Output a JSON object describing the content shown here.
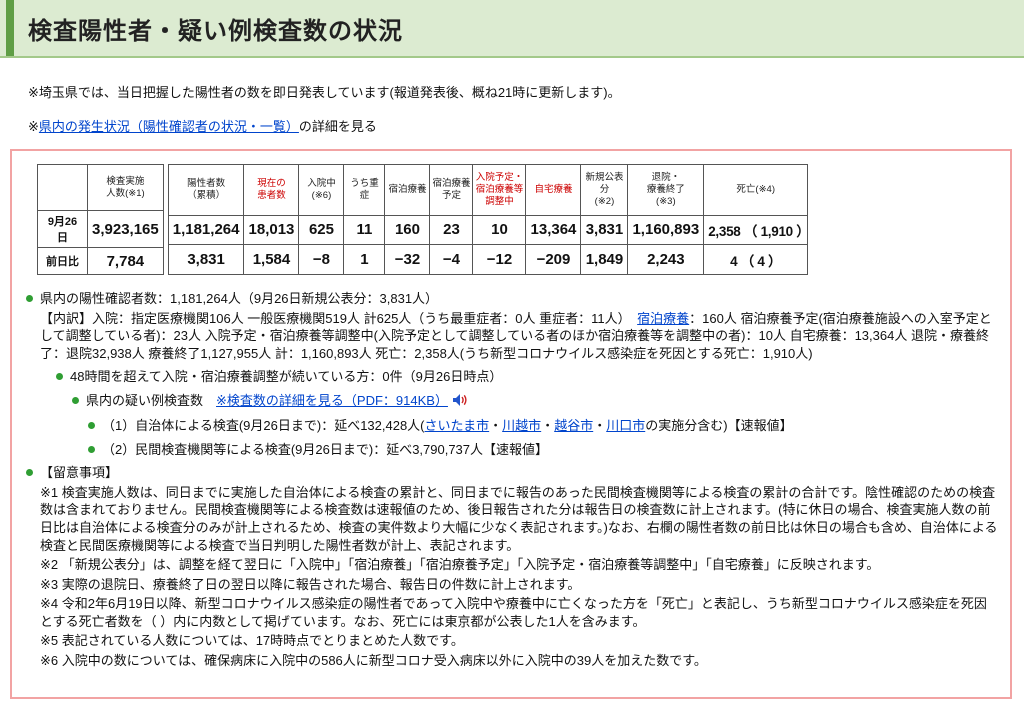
{
  "colors": {
    "header_bg": "#dcebd1",
    "header_accent_green": "#5f9e45",
    "box_border_pink": "#f2a3a3",
    "bullet_green": "#2f9e33",
    "link_blue": "#0044cc",
    "red_header_text": "#cc0000"
  },
  "page": {
    "title": "検査陽性者・疑い例検査数の状況"
  },
  "notes_top": {
    "note1": "※埼玉県では、当日把握した陽性者の数を即日発表しています(報道発表後、概ね21時に更新します)。",
    "note2_prefix": "※",
    "note2_link": "県内の発生状況（陽性確認者の状況・一覧）",
    "note2_suffix": "の詳細を見る"
  },
  "table": {
    "left": {
      "corner": "",
      "header": "検査実施\n人数(※1)",
      "rows": [
        {
          "label": "9月26日",
          "value": "3,923,165"
        },
        {
          "label": "前日比",
          "value": "7,784"
        }
      ]
    },
    "right": {
      "headers": [
        "陽性者数\n（累積）",
        "現在の\n患者数",
        "入院中\n(※6)",
        "うち重症",
        "宿泊療養",
        "宿泊療養\n予定",
        "入院予定・\n宿泊療養等\n調整中",
        "自宅療養",
        "新規公表分\n(※2)",
        "退院・\n療養終了\n(※3)",
        "死亡(※4)"
      ],
      "rows": [
        [
          "1,181,264",
          "18,013",
          "625",
          "11",
          "160",
          "23",
          "10",
          "13,364",
          "3,831",
          "1,160,893",
          "2,358 （ 1,910 ）"
        ],
        [
          "3,831",
          "1,584",
          "−8",
          "1",
          "−32",
          "−4",
          "−12",
          "−209",
          "1,849",
          "2,243",
          "4 （ 4 ）"
        ]
      ]
    }
  },
  "content": {
    "positive_total": "県内の陽性確認者数：1,181,264人（9月26日新規公表分：3,831人）",
    "breakdown": {
      "part1": "【内訳】入院：指定医療機関106人 一般医療機関519人 計625人（うち最重症者：0人 重症者：11人）　",
      "link": "宿泊療養",
      "part2": "：160人 宿泊療養予定(宿泊療養施設への入室予定として調整している者)：23人 入院予定・宿泊療養等調整中(入院予定として調整している者のほか宿泊療養等を調整中の者)：10人 自宅療養：13,364人 退院・療養終了：退院32,938人 療養終了1,127,955人 計：1,160,893人 死亡：2,358人(うち新型コロナウイルス感染症を死因とする死亡：1,910人)"
    },
    "adjustment_48h": "48時間を超えて入院・宿泊療養調整が続いている方：0件（9月26日時点）",
    "suspected": {
      "label": "県内の疑い例検査数　",
      "pdf_link": "※検査数の詳細を見る（PDF：914KB）"
    },
    "tests_municipal": {
      "part1": "（1）自治体による検査(9月26日まで)：延べ132,428人(",
      "links": [
        "さいたま市",
        "川越市",
        "越谷市",
        "川口市"
      ],
      "separator": "・",
      "part2": "の実施分含む)【速報値】"
    },
    "tests_private": "（2）民間検査機関等による検査(9月26日まで)：延べ3,790,737人【速報値】",
    "cautions_title": "【留意事項】",
    "cautions": [
      "※1 検査実施人数は、同日までに実施した自治体による検査の累計と、同日までに報告のあった民間検査機関等による検査の累計の合計です。陰性確認のための検査数は含まれておりません。民間検査機関等による検査数は速報値のため、後日報告された分は報告日の検査数に計上されます。(特に休日の場合、検査実施人数の前日比は自治体による検査分のみが計上されるため、検査の実件数より大幅に少なく表記されます。)なお、右欄の陽性者数の前日比は休日の場合も含め、自治体による検査と民間医療機関等による検査で当日判明した陽性者数が計上、表記されます。",
      "※2 「新規公表分」は、調整を経て翌日に「入院中」「宿泊療養」「宿泊療養予定」「入院予定・宿泊療養等調整中」「自宅療養」に反映されます。",
      "※3 実際の退院日、療養終了日の翌日以降に報告された場合、報告日の件数に計上されます。",
      "※4 令和2年6月19日以降、新型コロナウイルス感染症の陽性者であって入院中や療養中に亡くなった方を「死亡」と表記し、うち新型コロナウイルス感染症を死因とする死亡者数を（ ）内に内数として掲げています。なお、死亡には東京都が公表した1人を含みます。",
      "※5 表記されている人数については、17時時点でとりまとめた人数です。",
      "※6 入院中の数については、確保病床に入院中の586人に新型コロナ受入病床以外に入院中の39人を加えた数です。"
    ]
  }
}
